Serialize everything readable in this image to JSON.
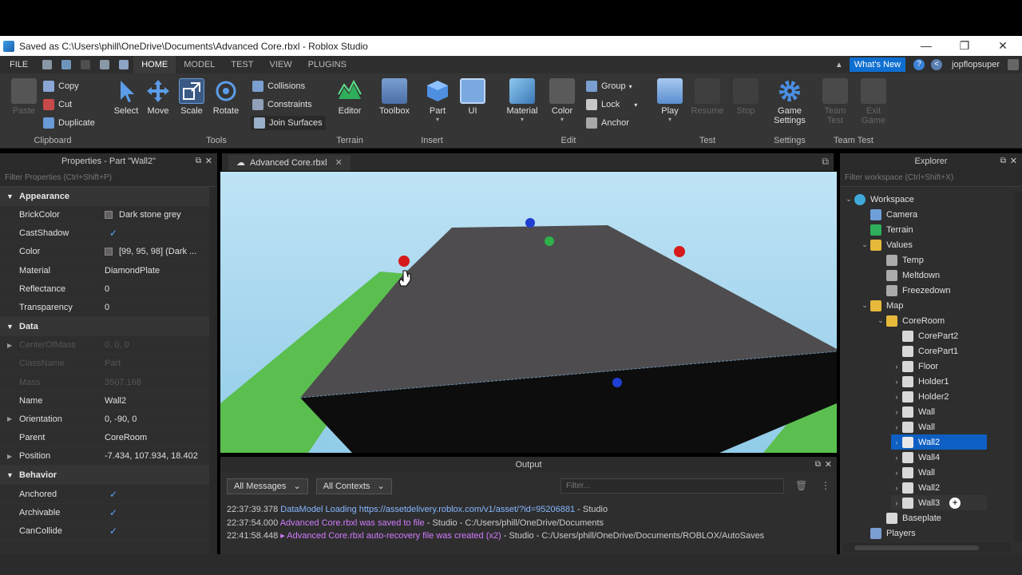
{
  "window": {
    "title": "Saved as C:\\Users\\phill\\OneDrive\\Documents\\Advanced Core.rbxl - Roblox Studio",
    "controls": [
      "—",
      "❐",
      "✕"
    ]
  },
  "menu": {
    "file": "FILE",
    "tabs": [
      "HOME",
      "MODEL",
      "TEST",
      "VIEW",
      "PLUGINS"
    ],
    "whats_new": "What's New",
    "username": "jopflopsuper"
  },
  "ribbon": {
    "clipboard": {
      "paste": "Paste",
      "copy": "Copy",
      "cut": "Cut",
      "duplicate": "Duplicate",
      "label": "Clipboard"
    },
    "tools": {
      "select": "Select",
      "move": "Move",
      "scale": "Scale",
      "rotate": "Rotate",
      "collisions": "Collisions",
      "constraints": "Constraints",
      "join": "Join Surfaces",
      "label": "Tools"
    },
    "terrain": {
      "editor": "Editor",
      "label": "Terrain"
    },
    "insert": {
      "toolbox": "Toolbox",
      "part": "Part",
      "ui": "UI",
      "label": "Insert"
    },
    "edit": {
      "material": "Material",
      "color": "Color",
      "group": "Group",
      "lock": "Lock",
      "anchor": "Anchor",
      "label": "Edit"
    },
    "test": {
      "play": "Play",
      "resume": "Resume",
      "stop": "Stop",
      "label": "Test"
    },
    "settings": {
      "game_settings_1": "Game",
      "game_settings_2": "Settings",
      "label": "Settings"
    },
    "team_test": {
      "team_test_1": "Team",
      "team_test_2": "Test",
      "exit_game_1": "Exit",
      "exit_game_2": "Game",
      "label": "Team Test"
    }
  },
  "properties": {
    "title": "Properties - Part \"Wall2\"",
    "filter_placeholder": "Filter Properties (Ctrl+Shift+P)",
    "sections": {
      "appearance": "Appearance",
      "data": "Data",
      "behavior": "Behavior"
    },
    "appearance": [
      {
        "name": "BrickColor",
        "value": "Dark stone grey"
      },
      {
        "name": "CastShadow",
        "value": "✓"
      },
      {
        "name": "Color",
        "value": "[99, 95, 98] (Dark ..."
      },
      {
        "name": "Material",
        "value": "DiamondPlate"
      },
      {
        "name": "Reflectance",
        "value": "0"
      },
      {
        "name": "Transparency",
        "value": "0"
      }
    ],
    "data": [
      {
        "name": "CenterOfMass",
        "value": "0, 0, 0"
      },
      {
        "name": "ClassName",
        "value": "Part"
      },
      {
        "name": "Mass",
        "value": "3507.168"
      },
      {
        "name": "Name",
        "value": "Wall2"
      },
      {
        "name": "Orientation",
        "value": "0, -90, 0"
      },
      {
        "name": "Parent",
        "value": "CoreRoom"
      },
      {
        "name": "Position",
        "value": "-7.434, 107.934, 18.402"
      }
    ],
    "behavior": [
      {
        "name": "Anchored",
        "value": "✓"
      },
      {
        "name": "Archivable",
        "value": "✓"
      },
      {
        "name": "CanCollide",
        "value": "✓"
      }
    ]
  },
  "viewport": {
    "tab": "Advanced Core.rbxl"
  },
  "output": {
    "title": "Output",
    "messages_filter": "All Messages",
    "contexts_filter": "All Contexts",
    "filter_placeholder": "Filter...",
    "lines": [
      {
        "time": "22:37:39.378",
        "text": "DataModel Loading https://assetdelivery.roblox.com/v1/asset/?id=95206881",
        "suffix": " - Studio"
      },
      {
        "time": "22:37:54.000",
        "text": "Advanced Core.rbxl was saved to file",
        "suffix": " - Studio - C:/Users/phill/OneDrive/Documents"
      },
      {
        "time": "22:41:58.448",
        "text": "▸ Advanced Core.rbxl auto-recovery file was created (x2)",
        "suffix": " - Studio - C:/Users/phill/OneDrive/Documents/ROBLOX/AutoSaves"
      }
    ]
  },
  "explorer": {
    "title": "Explorer",
    "filter_placeholder": "Filter workspace (Ctrl+Shift+X)",
    "items": [
      {
        "label": "Workspace",
        "arrow": "⌄"
      },
      {
        "label": "Camera",
        "arrow": ""
      },
      {
        "label": "Terrain",
        "arrow": ""
      },
      {
        "label": "Values",
        "arrow": "⌄"
      },
      {
        "label": "Temp",
        "arrow": ""
      },
      {
        "label": "Meltdown",
        "arrow": ""
      },
      {
        "label": "Freezedown",
        "arrow": ""
      },
      {
        "label": "Map",
        "arrow": "⌄"
      },
      {
        "label": "CoreRoom",
        "arrow": "⌄"
      },
      {
        "label": "CorePart2",
        "arrow": ""
      },
      {
        "label": "CorePart1",
        "arrow": ""
      },
      {
        "label": "Floor",
        "arrow": "›"
      },
      {
        "label": "Holder1",
        "arrow": "›"
      },
      {
        "label": "Holder2",
        "arrow": "›"
      },
      {
        "label": "Wall",
        "arrow": "›"
      },
      {
        "label": "Wall",
        "arrow": "›"
      },
      {
        "label": "Wall2",
        "arrow": "›"
      },
      {
        "label": "Wall4",
        "arrow": "›"
      },
      {
        "label": "Wall",
        "arrow": "›"
      },
      {
        "label": "Wall2",
        "arrow": "›"
      },
      {
        "label": "Wall3",
        "arrow": "›"
      },
      {
        "label": "Baseplate",
        "arrow": ""
      },
      {
        "label": "Players",
        "arrow": ""
      }
    ]
  },
  "colors": {
    "accent": "#0e5fc4",
    "sky": "#a7d6f0",
    "grass": "#5bbf4f",
    "part": "#4e4c4e"
  }
}
